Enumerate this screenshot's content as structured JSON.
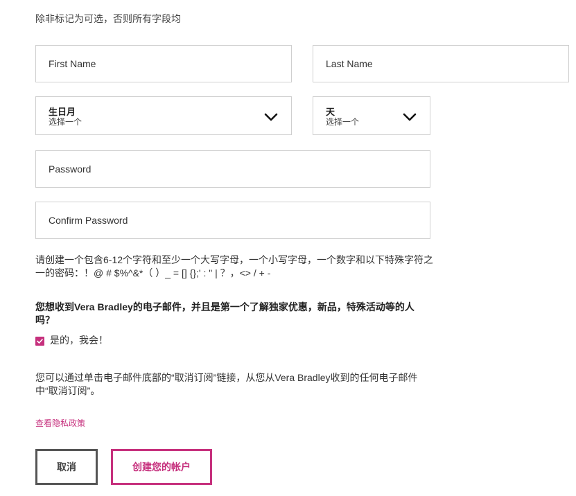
{
  "form": {
    "required_note": "除非标记为可选，否则所有字段均",
    "first_name_placeholder": "First Name",
    "last_name_placeholder": "Last Name",
    "birth_month": {
      "title": "生日月",
      "value": "选择一个"
    },
    "birth_day": {
      "title": "天",
      "value": "选择一个"
    },
    "password_placeholder": "Password",
    "confirm_password_placeholder": "Confirm Password",
    "password_rules": "请创建一个包含6-12个字符和至少一个大写字母，一个小写字母，一个数字和以下特殊字符之一的密码：！@ # $%^&*（ ）_ = [] {};' : \" | ？，<> / + -",
    "email_question": "您想收到Vera Bradley的电子邮件，并且是第一个了解独家优惠，新品，特殊活动等的人吗？",
    "email_opt_in_label": "是的，我会！",
    "email_opt_in_checked": true,
    "unsubscribe_note": "您可以通过单击电子邮件底部的“取消订阅”链接，从您从Vera Bradley收到的任何电子邮件中“取消订阅”。",
    "privacy_link": "查看隐私政策",
    "cancel_label": "取消",
    "create_label": "创建您的帐户"
  },
  "colors": {
    "accent": "#c6307d",
    "border": "#cfcfcf",
    "text": "#333333"
  },
  "icons": {
    "select_arrow": "chevron-down-icon",
    "checkbox_mark": "check-icon"
  }
}
